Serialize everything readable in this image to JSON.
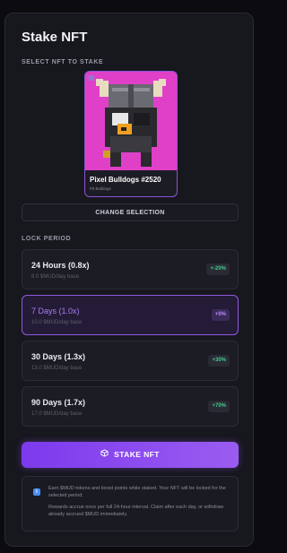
{
  "title": "Stake NFT",
  "select_label": "SELECT NFT TO STAKE",
  "nft": {
    "name": "Pixel Bulldogs #2520",
    "collection": "Pit Bulldogs"
  },
  "change_button": "CHANGE SELECTION",
  "lock_label": "LOCK PERIOD",
  "periods": [
    {
      "label": "24 Hours (0.8x)",
      "sub": "8.0 $MUD/day base",
      "badge": "+-20%",
      "selected": false
    },
    {
      "label": "7 Days (1.0x)",
      "sub": "10.0 $MUD/day base",
      "badge": "+0%",
      "selected": true
    },
    {
      "label": "30 Days (1.3x)",
      "sub": "13.0 $MUD/day base",
      "badge": "+30%",
      "selected": false
    },
    {
      "label": "90 Days (1.7x)",
      "sub": "17.0 $MUD/day base",
      "badge": "+70%",
      "selected": false
    }
  ],
  "stake_button": "STAKE NFT",
  "info": {
    "line1": "Earn $MUD tokens and boost points while staked. Your NFT will be locked for the selected period.",
    "line2": "Rewards accrue once per full 24-hour interval. Claim after each day, or withdraw already accrued $MUD immediately."
  },
  "colors": {
    "accent": "#8b5cf6",
    "positive": "#3ecf8e",
    "panel": "#17171e",
    "nft_bg": "#e040c8"
  },
  "icons": {
    "stake": "cube-icon",
    "info": "info-icon"
  }
}
